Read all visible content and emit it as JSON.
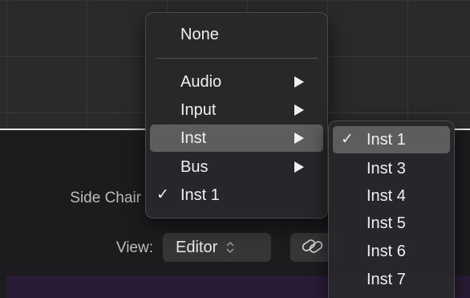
{
  "side_chain": {
    "label": "Side Chair",
    "current_value": "Inst 1"
  },
  "view": {
    "label": "View:",
    "selected": "Editor",
    "link_icon": "link-icon"
  },
  "menu": {
    "none_label": "None",
    "items": [
      {
        "label": "Audio",
        "has_submenu": true
      },
      {
        "label": "Input",
        "has_submenu": true
      },
      {
        "label": "Inst",
        "has_submenu": true,
        "highlighted": true
      },
      {
        "label": "Bus",
        "has_submenu": true
      }
    ],
    "checked_item": {
      "check": "✓",
      "label": "Inst 1"
    }
  },
  "submenu": {
    "items": [
      {
        "label": "Inst 1",
        "checked": true,
        "highlighted": true
      },
      {
        "label": "Inst 3"
      },
      {
        "label": "Inst 4"
      },
      {
        "label": "Inst 5"
      },
      {
        "label": "Inst 6"
      },
      {
        "label": "Inst 7"
      }
    ],
    "check": "✓"
  },
  "colors": {
    "grid_bg": "#2a2a2d",
    "panel_bg": "#1c1c1f",
    "menu_bg": "#28282b",
    "highlight": "#5d5d60",
    "purple_strip": "#2a1c36"
  }
}
